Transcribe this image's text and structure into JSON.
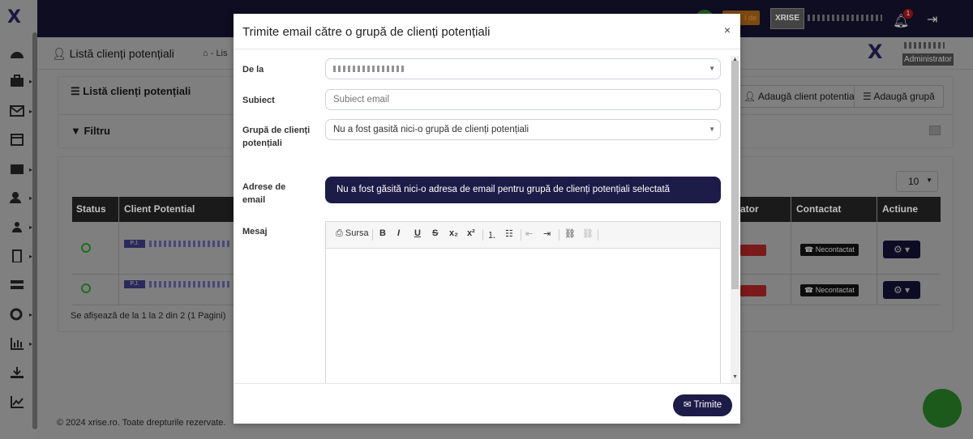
{
  "app": {
    "logo": "X",
    "badge_text": "I de",
    "notif_count": "1",
    "brand": "XRISE"
  },
  "breadcrumb": {
    "title": "Listă clienți potențiali",
    "home_tail": "Lis"
  },
  "user": {
    "role": "Administrator"
  },
  "list_card": {
    "title": "Listă clienți potențiali",
    "add_client": "Adaugă client potential",
    "add_group": "Adaugă grupă"
  },
  "filter": {
    "label": "Filtru"
  },
  "table": {
    "page_size": "10",
    "headers": {
      "status": "Status",
      "client": "Client Potential",
      "operator": "ator",
      "contacted": "Contactat",
      "actions": "Actiune"
    },
    "rows": [
      {
        "tag": "P.J.",
        "contact": "Necontactat"
      },
      {
        "tag": "P.J.",
        "contact": "Necontactat"
      }
    ],
    "summary": "Se afișează de la 1 la 2 din 2 (1 Pagini)"
  },
  "footer": {
    "copyright": "© 2024 xrise.ro. Toate drepturile rezervate."
  },
  "modal": {
    "title": "Trimite email către o grupă de clienți potențiali",
    "close": "×",
    "from_label": "De la",
    "subject_label": "Subiect",
    "subject_placeholder": "Subiect email",
    "group_label_1": "Grupă de clienți",
    "group_label_2": "potențiali",
    "group_value": "Nu a fost gasită nici-o grupă de clienți potențiali",
    "addresses_label_1": "Adrese de",
    "addresses_label_2": "email",
    "addresses_alert": "Nu a fost găsită nici-o adresa de email pentru grupă de clienți potențiali selectată",
    "message_label": "Mesaj",
    "editor_source": "Sursa",
    "send_label": "Trimite"
  }
}
